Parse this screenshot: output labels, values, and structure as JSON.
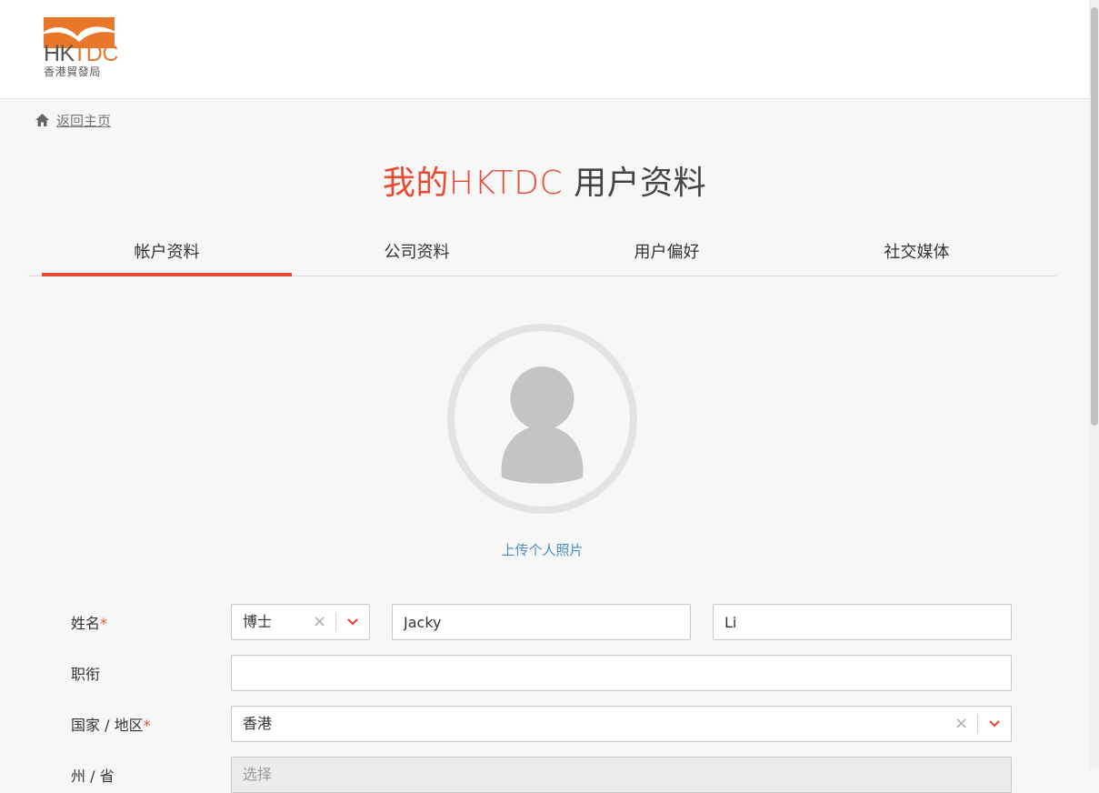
{
  "header": {
    "logo_text": "HKTDC",
    "logo_subtext": "香港貿發局",
    "brand_color": "#e84a32"
  },
  "breadcrumb": {
    "home_link": "返回主页"
  },
  "title": {
    "accent": "我的HKTDC",
    "rest": " 用户资料"
  },
  "tabs": [
    {
      "label": "帐户资料",
      "active": true
    },
    {
      "label": "公司资料",
      "active": false
    },
    {
      "label": "用户偏好",
      "active": false
    },
    {
      "label": "社交媒体",
      "active": false
    }
  ],
  "profile": {
    "upload_label": "上传个人照片"
  },
  "form": {
    "name": {
      "label": "姓名",
      "required_mark": "*",
      "salutation": "博士",
      "first_name": "Jacky",
      "last_name": "Li"
    },
    "job_title": {
      "label": "职衔",
      "value": ""
    },
    "country": {
      "label": "国家 / 地区",
      "required_mark": "*",
      "value": "香港"
    },
    "state": {
      "label": "州 / 省",
      "placeholder": "选择"
    }
  }
}
